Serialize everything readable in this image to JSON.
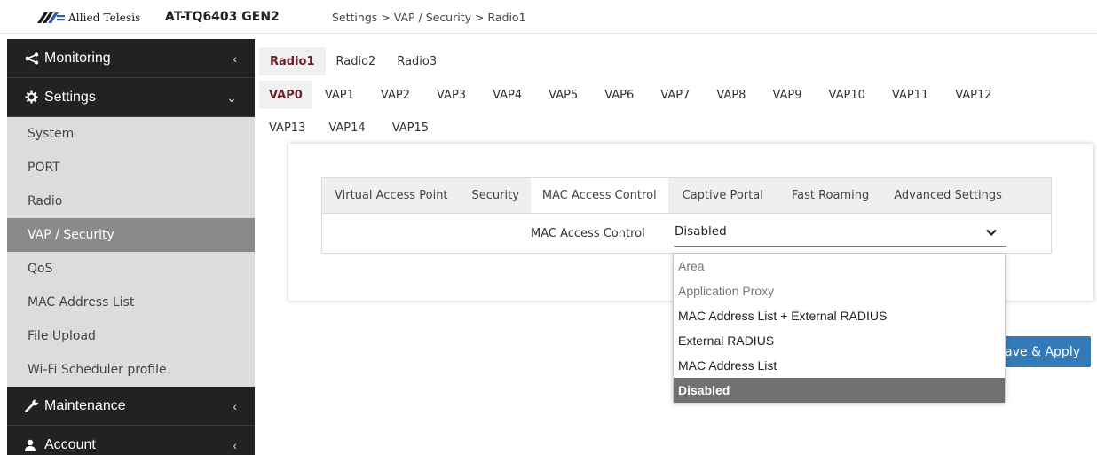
{
  "header": {
    "brand": "Allied Telesis",
    "model": "AT-TQ6403 GEN2",
    "breadcrumb": "Settings > VAP / Security > Radio1"
  },
  "sidebar": {
    "monitoring": "Monitoring",
    "settings": "Settings",
    "items": [
      "System",
      "PORT",
      "Radio",
      "VAP / Security",
      "QoS",
      "MAC Address List",
      "File Upload",
      "Wi-Fi Scheduler profile"
    ],
    "active_item": "VAP / Security",
    "maintenance": "Maintenance",
    "account": "Account"
  },
  "radio_tabs": [
    "Radio1",
    "Radio2",
    "Radio3"
  ],
  "vap_tabs_row1": [
    "VAP0",
    "VAP1",
    "VAP2",
    "VAP3",
    "VAP4",
    "VAP5",
    "VAP6",
    "VAP7",
    "VAP8",
    "VAP9",
    "VAP10",
    "VAP11",
    "VAP12"
  ],
  "vap_tabs_row2": [
    "VAP13",
    "VAP14",
    "VAP15"
  ],
  "inner_tabs": [
    "Virtual Access Point",
    "Security",
    "MAC Access Control",
    "Captive Portal",
    "Fast Roaming",
    "Advanced Settings"
  ],
  "form": {
    "label": "MAC Access Control",
    "value": "Disabled"
  },
  "dropdown_options": [
    "Area",
    "Application Proxy",
    "MAC Address List + External RADIUS",
    "External RADIUS",
    "MAC Address List",
    "Disabled"
  ],
  "save_button": "Save & Apply",
  "colors": {
    "sidebar_bg": "#222222",
    "active_item_bg": "#8a8a8a",
    "accent_blue": "#337ab7",
    "active_tab_text": "#6b1f2a"
  }
}
